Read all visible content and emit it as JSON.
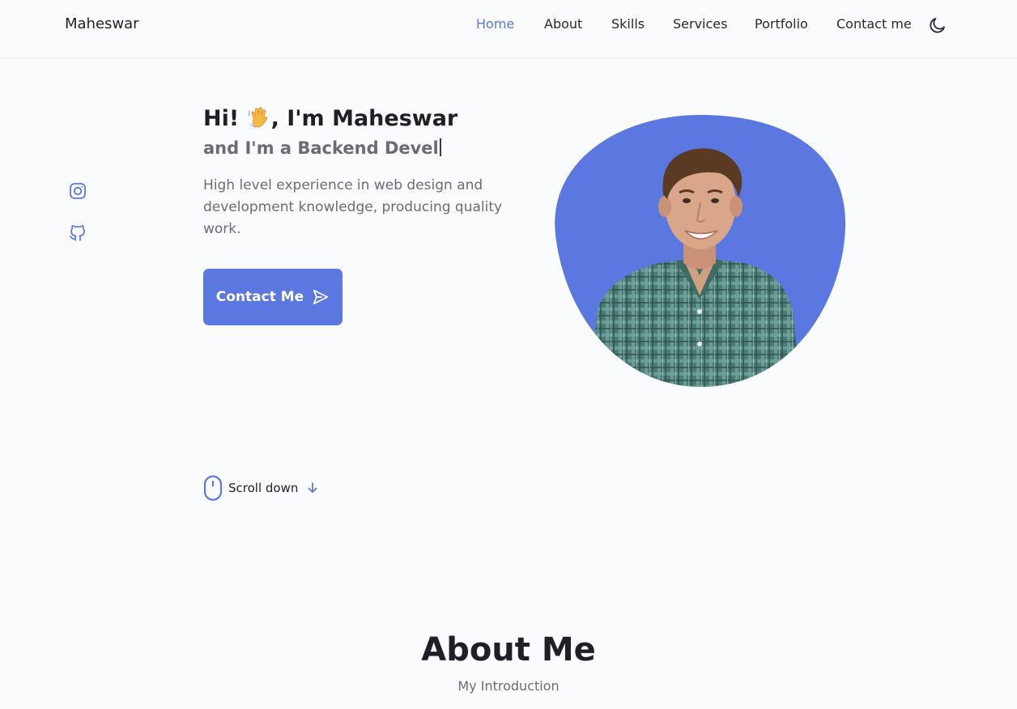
{
  "header": {
    "logo": "Maheswar",
    "nav": [
      {
        "label": "Home",
        "active": true
      },
      {
        "label": "About",
        "active": false
      },
      {
        "label": "Skills",
        "active": false
      },
      {
        "label": "Services",
        "active": false
      },
      {
        "label": "Portfolio",
        "active": false
      },
      {
        "label": "Contact me",
        "active": false
      }
    ],
    "theme_toggle_icon": "moon-icon"
  },
  "socials": [
    {
      "icon": "instagram-icon"
    },
    {
      "icon": "github-icon"
    }
  ],
  "hero": {
    "greeting_prefix": "Hi! ",
    "greeting_emoji": "waving-hand-icon",
    "greeting_suffix": ", I'm Maheswar",
    "typed_text": "and I'm a Backend Devel",
    "description": "High level experience in web design and development knowledge, producing quality work.",
    "cta_label": "Contact Me",
    "cta_icon": "send-icon",
    "profile_image": "profile-photo"
  },
  "scroll": {
    "label": "Scroll down",
    "icon": "mouse-icon",
    "arrow_icon": "arrow-down-icon"
  },
  "about": {
    "title": "About Me",
    "subtitle": "My Introduction"
  },
  "colors": {
    "accent": "#5a78e0",
    "background": "#fafbfd",
    "text": "#1f1f27",
    "muted": "#6b6c78"
  }
}
